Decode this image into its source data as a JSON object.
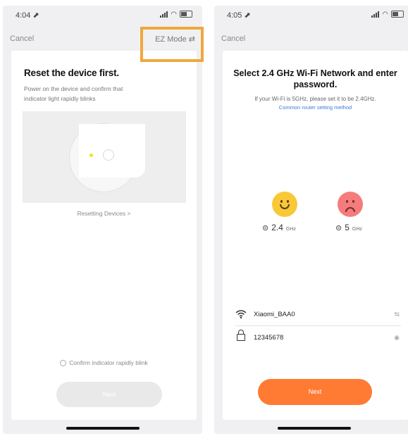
{
  "left": {
    "status": {
      "time": "4:04 ⬈"
    },
    "nav": {
      "cancel": "Cancel",
      "mode": "EZ Mode ⇄"
    },
    "title": "Reset the device first.",
    "subtitle": "Power on the device and confirm that indicator light rapidly blinks",
    "reset_link": "Resetting Devices >",
    "confirm": "Confirm indicator rapidly blink",
    "next": "Next"
  },
  "right": {
    "status": {
      "time": "4:05 ⬈"
    },
    "nav": {
      "cancel": "Cancel"
    },
    "title": "Select 2.4 GHz Wi-Fi Network and enter password.",
    "subtitle": "If your Wi-Fi is 5GHz, please set it to be 2.4GHz.",
    "link": "Common router setting method",
    "band_ok": {
      "num": "2.4",
      "unit": "GHz"
    },
    "band_bad": {
      "num": "5",
      "unit": "GHz"
    },
    "ssid": "Xiaomi_BAA0",
    "password": "12345678",
    "next": "Next"
  },
  "colors": {
    "accent": "#ff7b33",
    "highlight": "#f0a83c",
    "link": "#3a7bd5"
  }
}
